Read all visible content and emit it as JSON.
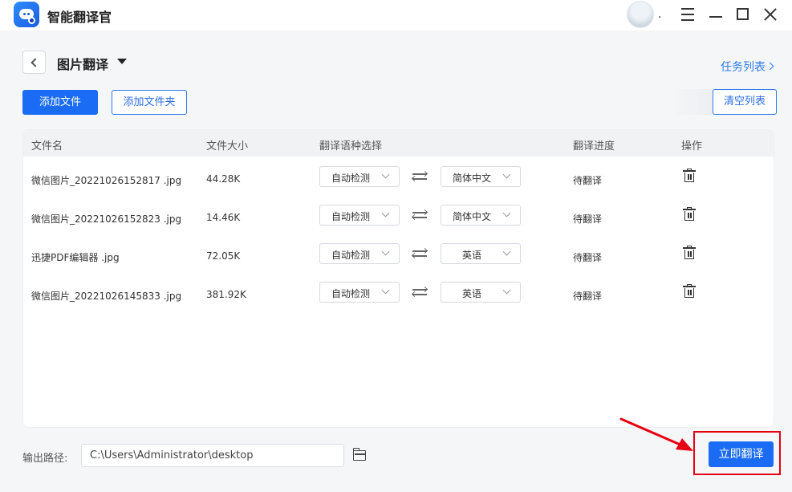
{
  "app": {
    "title": "智能翻译官"
  },
  "titlebar": {
    "avatar_dot": "."
  },
  "page": {
    "title": "图片翻译",
    "task_list": "任务列表"
  },
  "toolbar": {
    "add_file": "添加文件",
    "add_folder": "添加文件夹",
    "clear_list": "清空列表"
  },
  "table": {
    "headers": {
      "name": "文件名",
      "size": "文件大小",
      "lang": "翻译语种选择",
      "progress": "翻译进度",
      "action": "操作"
    },
    "rows": [
      {
        "name": "微信图片_20221026152817 .jpg",
        "size": "44.28K",
        "source": "自动检测",
        "target": "简体中文",
        "progress": "待翻译"
      },
      {
        "name": "微信图片_20221026152823 .jpg",
        "size": "14.46K",
        "source": "自动检测",
        "target": "简体中文",
        "progress": "待翻译"
      },
      {
        "name": "迅捷PDF编辑器 .jpg",
        "size": "72.05K",
        "source": "自动检测",
        "target": "英语",
        "progress": "待翻译"
      },
      {
        "name": "微信图片_20221026145833 .jpg",
        "size": "381.92K",
        "source": "自动检测",
        "target": "英语",
        "progress": "待翻译"
      }
    ]
  },
  "footer": {
    "output_label": "输出路径:",
    "output_path": "C:\\Users\\Administrator\\desktop",
    "translate_now": "立即翻译"
  },
  "colors": {
    "accent": "#1a6cf5",
    "annotation": "#e60012"
  },
  "icons": [
    "app-logo-icon",
    "avatar",
    "menu-icon",
    "minimize-icon",
    "maximize-icon",
    "close-icon",
    "back-icon",
    "caret-down-icon",
    "chevron-right-icon",
    "swap-icon",
    "trash-icon",
    "folder-icon",
    "arrow-annotation"
  ]
}
